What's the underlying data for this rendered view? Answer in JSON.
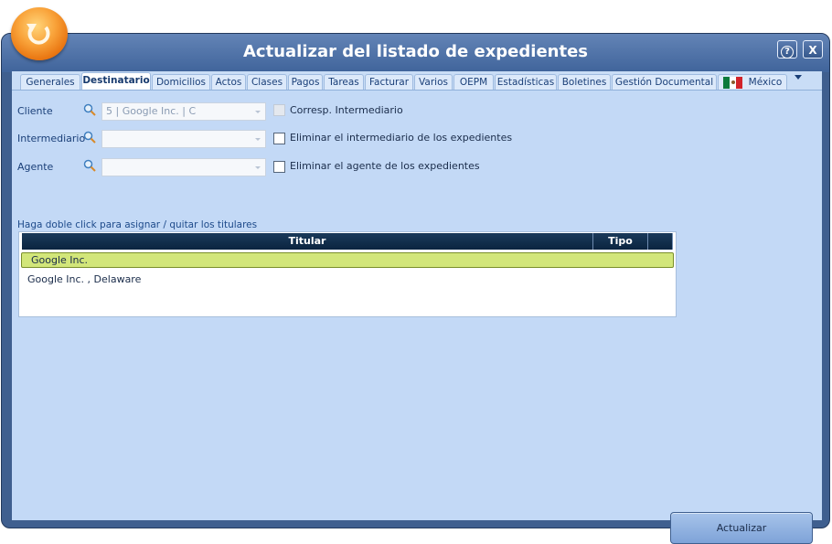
{
  "window": {
    "title": "Actualizar del listado de expedientes",
    "help_label": "?",
    "close_label": "X"
  },
  "tabs": [
    {
      "label": "Generales",
      "active": false
    },
    {
      "label": "Destinatario",
      "active": true
    },
    {
      "label": "Domicilios",
      "active": false
    },
    {
      "label": "Actos",
      "active": false
    },
    {
      "label": "Clases",
      "active": false
    },
    {
      "label": "Pagos",
      "active": false
    },
    {
      "label": "Tareas",
      "active": false
    },
    {
      "label": "Facturar",
      "active": false
    },
    {
      "label": "Varios",
      "active": false
    },
    {
      "label": "OEPM",
      "active": false
    },
    {
      "label": "Estadísticas",
      "active": false
    },
    {
      "label": "Boletines",
      "active": false
    },
    {
      "label": "Gestión Documental",
      "active": false
    },
    {
      "label": "México",
      "active": false,
      "icon": "mexico-flag-icon"
    }
  ],
  "form": {
    "cliente": {
      "label": "Cliente",
      "value": "5 | Google Inc. | C"
    },
    "intermediario": {
      "label": "Intermediario",
      "value": ""
    },
    "agente": {
      "label": "Agente",
      "value": ""
    },
    "checks": {
      "corresp": {
        "label": "Corresp. Intermediario",
        "checked": false,
        "disabled": true
      },
      "elim_intermediario": {
        "label": "Eliminar el intermediario de los expedientes",
        "checked": false
      },
      "elim_agente": {
        "label": "Eliminar el agente de los expedientes",
        "checked": false
      }
    }
  },
  "titulares": {
    "hint": "Haga doble click para asignar / quitar los titulares",
    "columns": [
      "Titular",
      "Tipo",
      ""
    ],
    "selected_row": "Google Inc.",
    "rows": [
      "Google Inc. , Delaware"
    ]
  },
  "actions": {
    "update_label": "Actualizar"
  },
  "colors": {
    "window_frame": "#3f5f8f",
    "panel_bg": "#c3d9f6",
    "header_dark": "#0b2440",
    "selected_row": "#d2e67a",
    "logo_orange": "#f9a33a"
  }
}
